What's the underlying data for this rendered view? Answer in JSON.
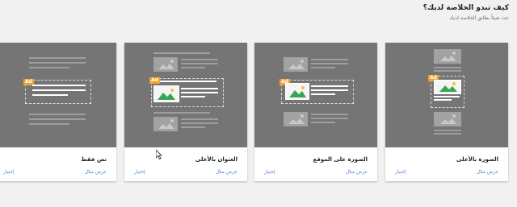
{
  "header": {
    "title": "كيف تبدو الخلاصة لديك؟",
    "subtitle": "حدد شيئاً يطابق الخلاصة لديك"
  },
  "cards": [
    {
      "name": "الصورة بالأعلى",
      "example_label": "عرض مثال",
      "choose_label": "إختيار",
      "ad_badge": "Ad"
    },
    {
      "name": "الصورة على الموقع",
      "example_label": "عرض مثال",
      "choose_label": "إختيار",
      "ad_badge": "Ad"
    },
    {
      "name": "العنوان بالأعلى",
      "example_label": "عرض مثال",
      "choose_label": "إختيار",
      "ad_badge": "Ad"
    },
    {
      "name": "نص فقط",
      "example_label": "عرض مثال",
      "choose_label": "إختيار",
      "ad_badge": "Ad"
    }
  ],
  "colors": {
    "preview_bg": "#757575",
    "ad_badge": "#f2a22a",
    "link": "#4a7fd0",
    "image_green": "#3aa655",
    "image_sun": "#f2c23a"
  }
}
